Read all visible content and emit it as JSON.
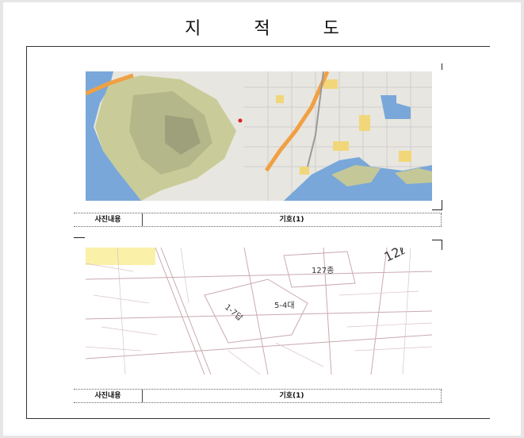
{
  "document": {
    "title": "지 적 도"
  },
  "panels": [
    {
      "map_type": "aerial-terrain-map",
      "caption_label": "사진내용",
      "caption_value": "기호(1)"
    },
    {
      "map_type": "cadastral-line-map",
      "caption_label": "사진내용",
      "caption_value": "기호(1)",
      "annotations": [
        "127종",
        "5-4대",
        "1-7답",
        "12ℓ"
      ]
    }
  ]
}
